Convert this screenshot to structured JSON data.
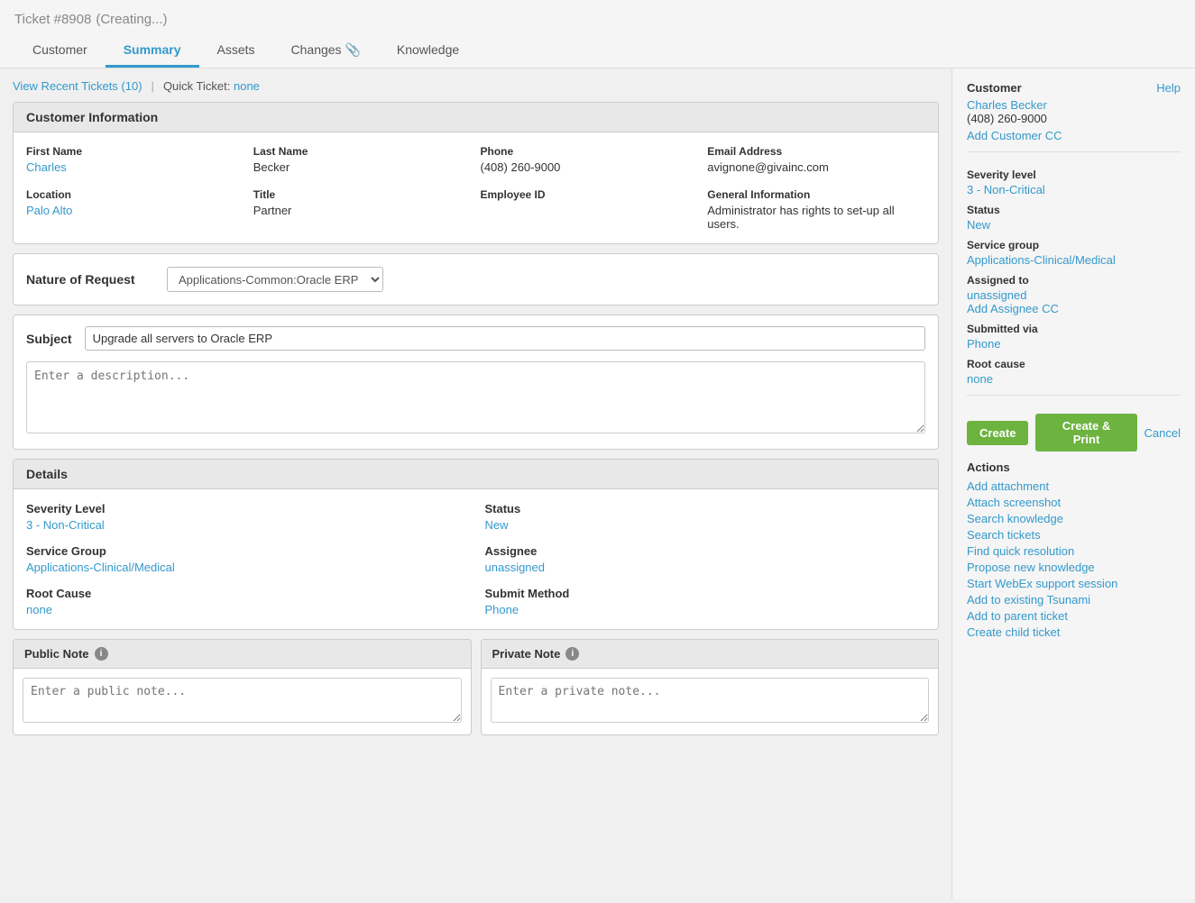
{
  "header": {
    "ticket_number": "Ticket #8908",
    "ticket_status": "(Creating...)",
    "tabs": [
      {
        "label": "Customer",
        "active": false
      },
      {
        "label": "Summary",
        "active": true
      },
      {
        "label": "Assets",
        "active": false
      },
      {
        "label": "Changes",
        "active": false,
        "has_attachment": true
      },
      {
        "label": "Knowledge",
        "active": false
      }
    ]
  },
  "quick_bar": {
    "recent_tickets_label": "View Recent Tickets (10)",
    "quick_ticket_label": "Quick Ticket:",
    "quick_ticket_value": "none"
  },
  "customer_info": {
    "panel_title": "Customer Information",
    "fields": [
      {
        "label": "First Name",
        "value": "Charles",
        "is_link": true
      },
      {
        "label": "Last Name",
        "value": "Becker",
        "is_link": false
      },
      {
        "label": "Phone",
        "value": "(408) 260-9000",
        "is_link": false
      },
      {
        "label": "Email Address",
        "value": "avignone@givainc.com",
        "is_link": false
      },
      {
        "label": "Location",
        "value": "Palo Alto",
        "is_link": true
      },
      {
        "label": "Title",
        "value": "Partner",
        "is_link": false
      },
      {
        "label": "Employee ID",
        "value": "",
        "is_link": false
      },
      {
        "label": "General Information",
        "value": "Administrator has rights to set-up all users.",
        "is_link": false
      }
    ]
  },
  "nature_of_request": {
    "label": "Nature of Request",
    "value": "Applications-Common:Oracle ERP"
  },
  "subject": {
    "label": "Subject",
    "value": "Upgrade all servers to Oracle ERP",
    "placeholder": "Upgrade all servers to Oracle ERP"
  },
  "description": {
    "placeholder": "Enter a description..."
  },
  "details": {
    "panel_title": "Details",
    "severity_label": "Severity Level",
    "severity_value": "3 - Non-Critical",
    "status_label": "Status",
    "status_value": "New",
    "service_group_label": "Service Group",
    "service_group_value": "Applications-Clinical/Medical",
    "assignee_label": "Assignee",
    "assignee_value": "unassigned",
    "root_cause_label": "Root Cause",
    "root_cause_value": "none",
    "submit_method_label": "Submit Method",
    "submit_method_value": "Phone"
  },
  "notes": {
    "public_note_label": "Public Note",
    "public_note_placeholder": "Enter a public note...",
    "private_note_label": "Private Note",
    "private_note_placeholder": "Enter a private note..."
  },
  "sidebar": {
    "customer_label": "Customer",
    "help_label": "Help",
    "customer_name": "Charles Becker",
    "customer_phone": "(408) 260-9000",
    "add_customer_cc": "Add Customer CC",
    "severity_label": "Severity level",
    "severity_value": "3 - Non-Critical",
    "status_label": "Status",
    "status_value": "New",
    "service_group_label": "Service group",
    "service_group_value": "Applications-Clinical/Medical",
    "assigned_to_label": "Assigned to",
    "assigned_to_value": "unassigned",
    "add_assignee_cc": "Add Assignee CC",
    "submitted_via_label": "Submitted via",
    "submitted_via_value": "Phone",
    "root_cause_label": "Root cause",
    "root_cause_value": "none",
    "create_label": "Create",
    "create_print_label": "Create & Print",
    "cancel_label": "Cancel",
    "actions_title": "Actions",
    "actions": [
      "Add attachment",
      "Attach screenshot",
      "Search knowledge",
      "Search tickets",
      "Find quick resolution",
      "Propose new knowledge",
      "Start WebEx support session",
      "Add to existing Tsunami",
      "Add to parent ticket",
      "Create child ticket"
    ]
  }
}
